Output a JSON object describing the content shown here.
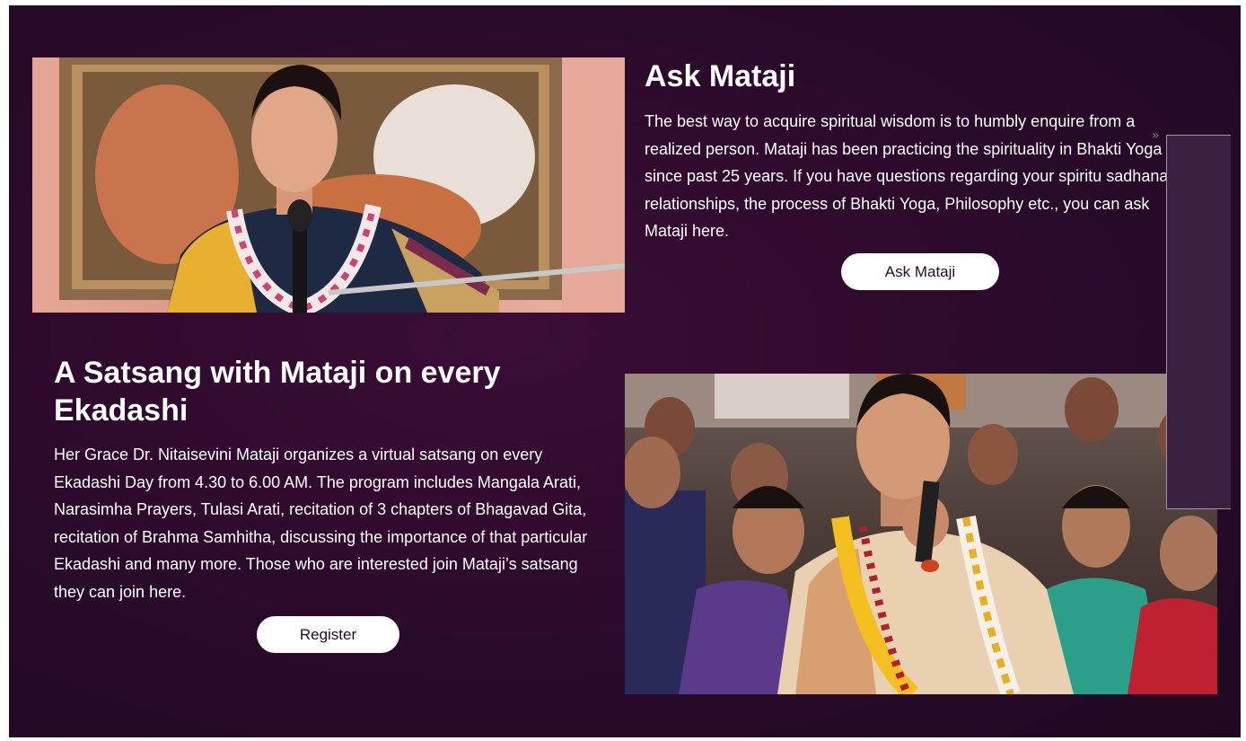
{
  "ask": {
    "title": "Ask Mataji",
    "text": "The best way to acquire spiritual wisdom is to humbly enquire from a realized person. Mataji has been practicing the spirituality in Bhakti Yoga since past 25 years. If you have questions regarding your spiritu sadhana, relationships, the process of Bhakti Yoga, Philosophy etc., you can ask Mataji here.",
    "button_label": "Ask Mataji"
  },
  "satsang": {
    "title": "A Satsang with Mataji on every Ekadashi",
    "text": "Her Grace Dr. Nitaisevini Mataji organizes a virtual satsang on every Ekadashi Day from 4.30 to 6.00 AM. The program includes Mangala Arati, Narasimha Prayers, Tulasi Arati, recitation of 3 chapters of Bhagavad Gita, recitation of Brahma Samhitha, discussing the importance of that particular Ekadashi and many more. Those who are interested join Mataji’s satsang they can join here.",
    "button_label": "Register"
  },
  "side_panel": {
    "chevron": "»"
  },
  "colors": {
    "background": "#2a0a2a",
    "button_bg": "#ffffff",
    "button_text": "#2a0a2a",
    "panel": "#3b2140"
  }
}
